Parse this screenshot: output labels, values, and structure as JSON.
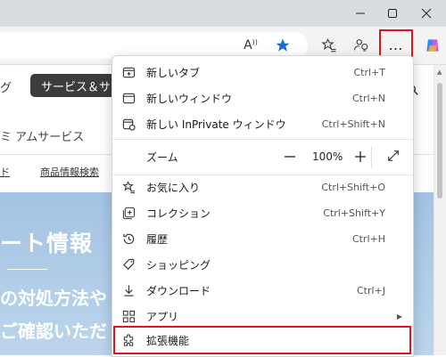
{
  "window": {
    "minimize_icon": "minimize-icon",
    "maximize_icon": "maximize-icon",
    "close_icon": "close-icon"
  },
  "toolbar": {
    "read_aloud_label": "A",
    "more_label": "…",
    "accent_highlight": "#e5121a"
  },
  "page": {
    "nav_left": "グ",
    "nav_pill": "サービス＆サ",
    "subtitle": "ミ アムサービス",
    "link_left": "ド",
    "link_product": "商品情報検索",
    "hero_title": "ート情報",
    "hero_line1": "の対処方法や",
    "hero_line2": "ご確認いただ"
  },
  "menu": {
    "items": [
      {
        "label": "新しいタブ",
        "shortcut": "Ctrl+T",
        "icon": "new-tab-icon"
      },
      {
        "label": "新しいウィンドウ",
        "shortcut": "Ctrl+N",
        "icon": "new-window-icon"
      },
      {
        "label": "新しい InPrivate ウィンドウ",
        "shortcut": "Ctrl+Shift+N",
        "icon": "inprivate-icon"
      }
    ],
    "zoom": {
      "label": "ズーム",
      "minus": "—",
      "value": "100%",
      "plus": "+"
    },
    "items2": [
      {
        "label": "お気に入り",
        "shortcut": "Ctrl+Shift+O",
        "icon": "favorites-icon"
      },
      {
        "label": "コレクション",
        "shortcut": "Ctrl+Shift+Y",
        "icon": "collections-icon"
      },
      {
        "label": "履歴",
        "shortcut": "Ctrl+H",
        "icon": "history-icon"
      },
      {
        "label": "ショッピング",
        "shortcut": "",
        "icon": "shopping-icon"
      },
      {
        "label": "ダウンロード",
        "shortcut": "Ctrl+J",
        "icon": "download-icon"
      },
      {
        "label": "アプリ",
        "shortcut": "",
        "icon": "apps-icon"
      },
      {
        "label": "拡張機能",
        "shortcut": "",
        "icon": "extensions-icon"
      }
    ]
  }
}
